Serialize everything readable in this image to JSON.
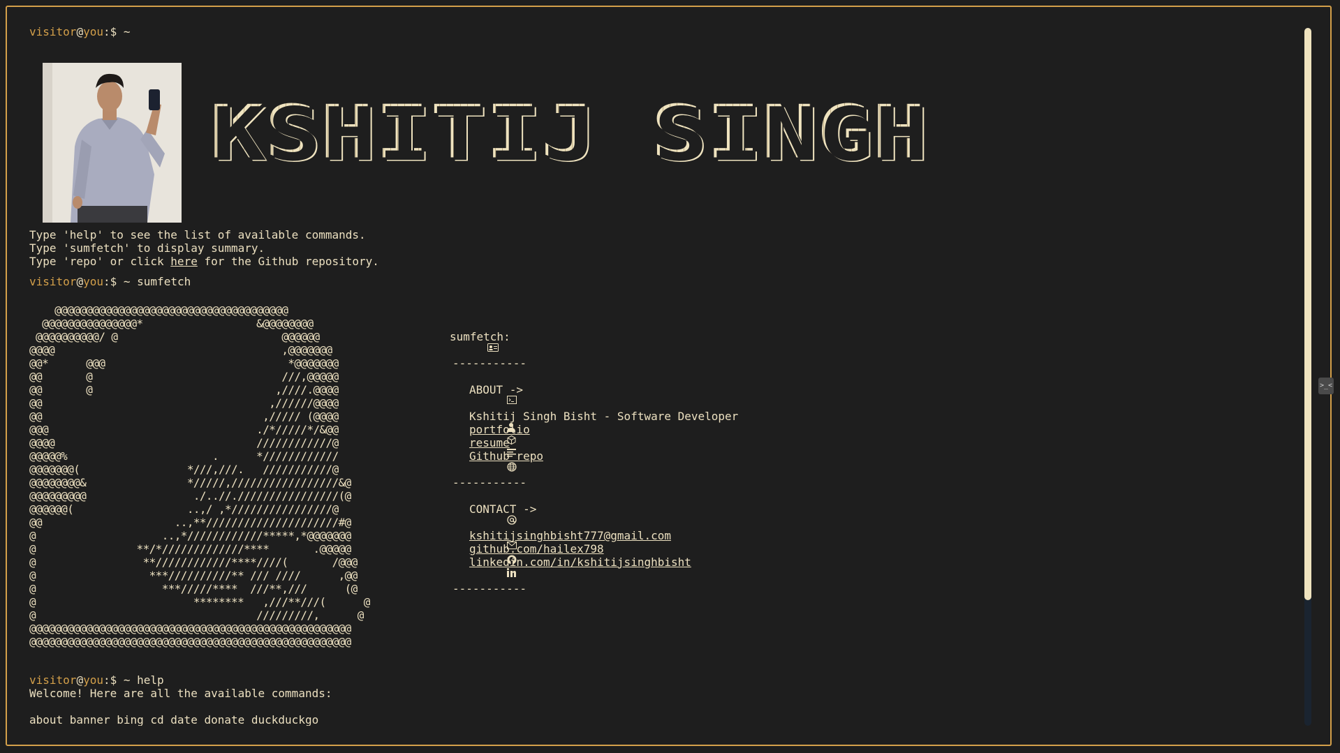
{
  "prompt": {
    "user": "visitor",
    "at": "@",
    "host": "you",
    "suffix": ":$ ~"
  },
  "initial_prompt": {
    "command": ""
  },
  "banner": {
    "title": "KSHITIJ SINGH"
  },
  "intro": {
    "line1": "Type 'help' to see the list of available commands.",
    "line2": "Type 'sumfetch' to display summary.",
    "line3_before": "Type 'repo' or click ",
    "line3_link": "here",
    "line3_after": " for the Github repository."
  },
  "sumfetch_prompt": {
    "command": "sumfetch"
  },
  "sumfetch": {
    "ascii_art": "    @@@@@@@@@@@@@@@@@@@@@@@@@@@@@@@@@@@@@\n  @@@@@@@@@@@@@@@*                  &@@@@@@@@\n @@@@@@@@@@/ @                          @@@@@@\n@@@@                                    ,@@@@@@@\n@@*      @@@                             *@@@@@@@\n@@       @                              ///,@@@@@\n@@       @                             ,////.@@@@\n@@                                    ,//////@@@@\n@@                                   ,///// (@@@@\n@@@                                 ./*/////*/&@@\n@@@@                                ////////////@\n@@@@@%                       .      *////////////\n@@@@@@@(                 *///,///.   ///////////@\n@@@@@@@@&                */////,/////////////////&@\n@@@@@@@@@                 ./..//.////////////////(@\n@@@@@@(                  ..,/ ,*////////////////@\n@@                     ..,**/////////////////////#@\n@                    ..,*////////////*****,*@@@@@@@\n@                **/*/////////////****       .@@@@@\n@                 **////////////****////(       /@@@\n@                  ***//////////** /// ////      ,@@\n@                    ***/////****  ///**,///      (@\n@                         ********   ,///**///(      @\n@                                   /////////,      @\n@@@@@@@@@@@@@@@@@@@@@@@@@@@@@@@@@@@@@@@@@@@@@@@@@@@\n@@@@@@@@@@@@@@@@@@@@@@@@@@@@@@@@@@@@@@@@@@@@@@@@@@@",
    "header": "sumfetch:",
    "separator": "-----------",
    "about_label": "ABOUT ->",
    "name_line": "Kshitij Singh Bisht - Software Developer",
    "portfolio_label": "portfolio",
    "resume_label": "resume",
    "github_repo_label": "Github repo",
    "contact_label": "CONTACT ->",
    "email": "kshitijsinghbisht777@gmail.com",
    "github": "github.com/hailex798",
    "linkedin": "linkedin.com/in/kshitijsinghbisht"
  },
  "help_prompt": {
    "command": "help"
  },
  "help": {
    "welcome": "Welcome! Here are all the available commands:",
    "commands_partial": "about banner bing cd date donate duckduckgo"
  },
  "colors": {
    "background": "#1e1e1e",
    "foreground": "#ece0c0",
    "accent": "#d4a04a",
    "scrollbar_thumb": "#efe3bf"
  },
  "icons": {
    "id_card": "id-card-icon",
    "terminal": "terminal-icon",
    "user": "user-icon",
    "portfolio": "box-icon",
    "resume": "document-icon",
    "repo": "globe-icon",
    "contact": "at-icon",
    "email": "mail-icon",
    "github": "github-icon",
    "linkedin": "linkedin-icon"
  }
}
